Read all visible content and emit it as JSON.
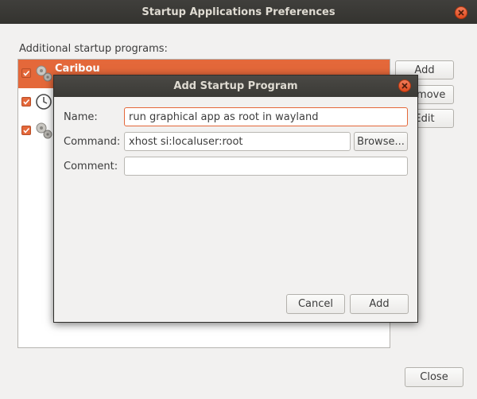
{
  "main_window": {
    "title": "Startup Applications Preferences",
    "section_label": "Additional startup programs:",
    "programs": [
      {
        "name": "Caribou",
        "checked": true,
        "selected": true,
        "icon": "gears-icon"
      },
      {
        "name": "",
        "checked": true,
        "selected": false,
        "icon": "clock-icon"
      },
      {
        "name": "",
        "checked": true,
        "selected": false,
        "icon": "gears-icon"
      }
    ],
    "buttons": {
      "add": "Add",
      "remove": "Remove",
      "edit": "Edit",
      "close": "Close"
    }
  },
  "dialog": {
    "title": "Add Startup Program",
    "name_label": "Name:",
    "name_value": "run graphical app as root in wayland",
    "command_label": "Command:",
    "command_value": "xhost si:localuser:root",
    "comment_label": "Comment:",
    "comment_value": "",
    "browse_label": "Browse...",
    "cancel_label": "Cancel",
    "add_label": "Add"
  },
  "colors": {
    "accent": "#e4683a",
    "titlebar": "#3c3b37",
    "window_bg": "#f2f1f0"
  }
}
